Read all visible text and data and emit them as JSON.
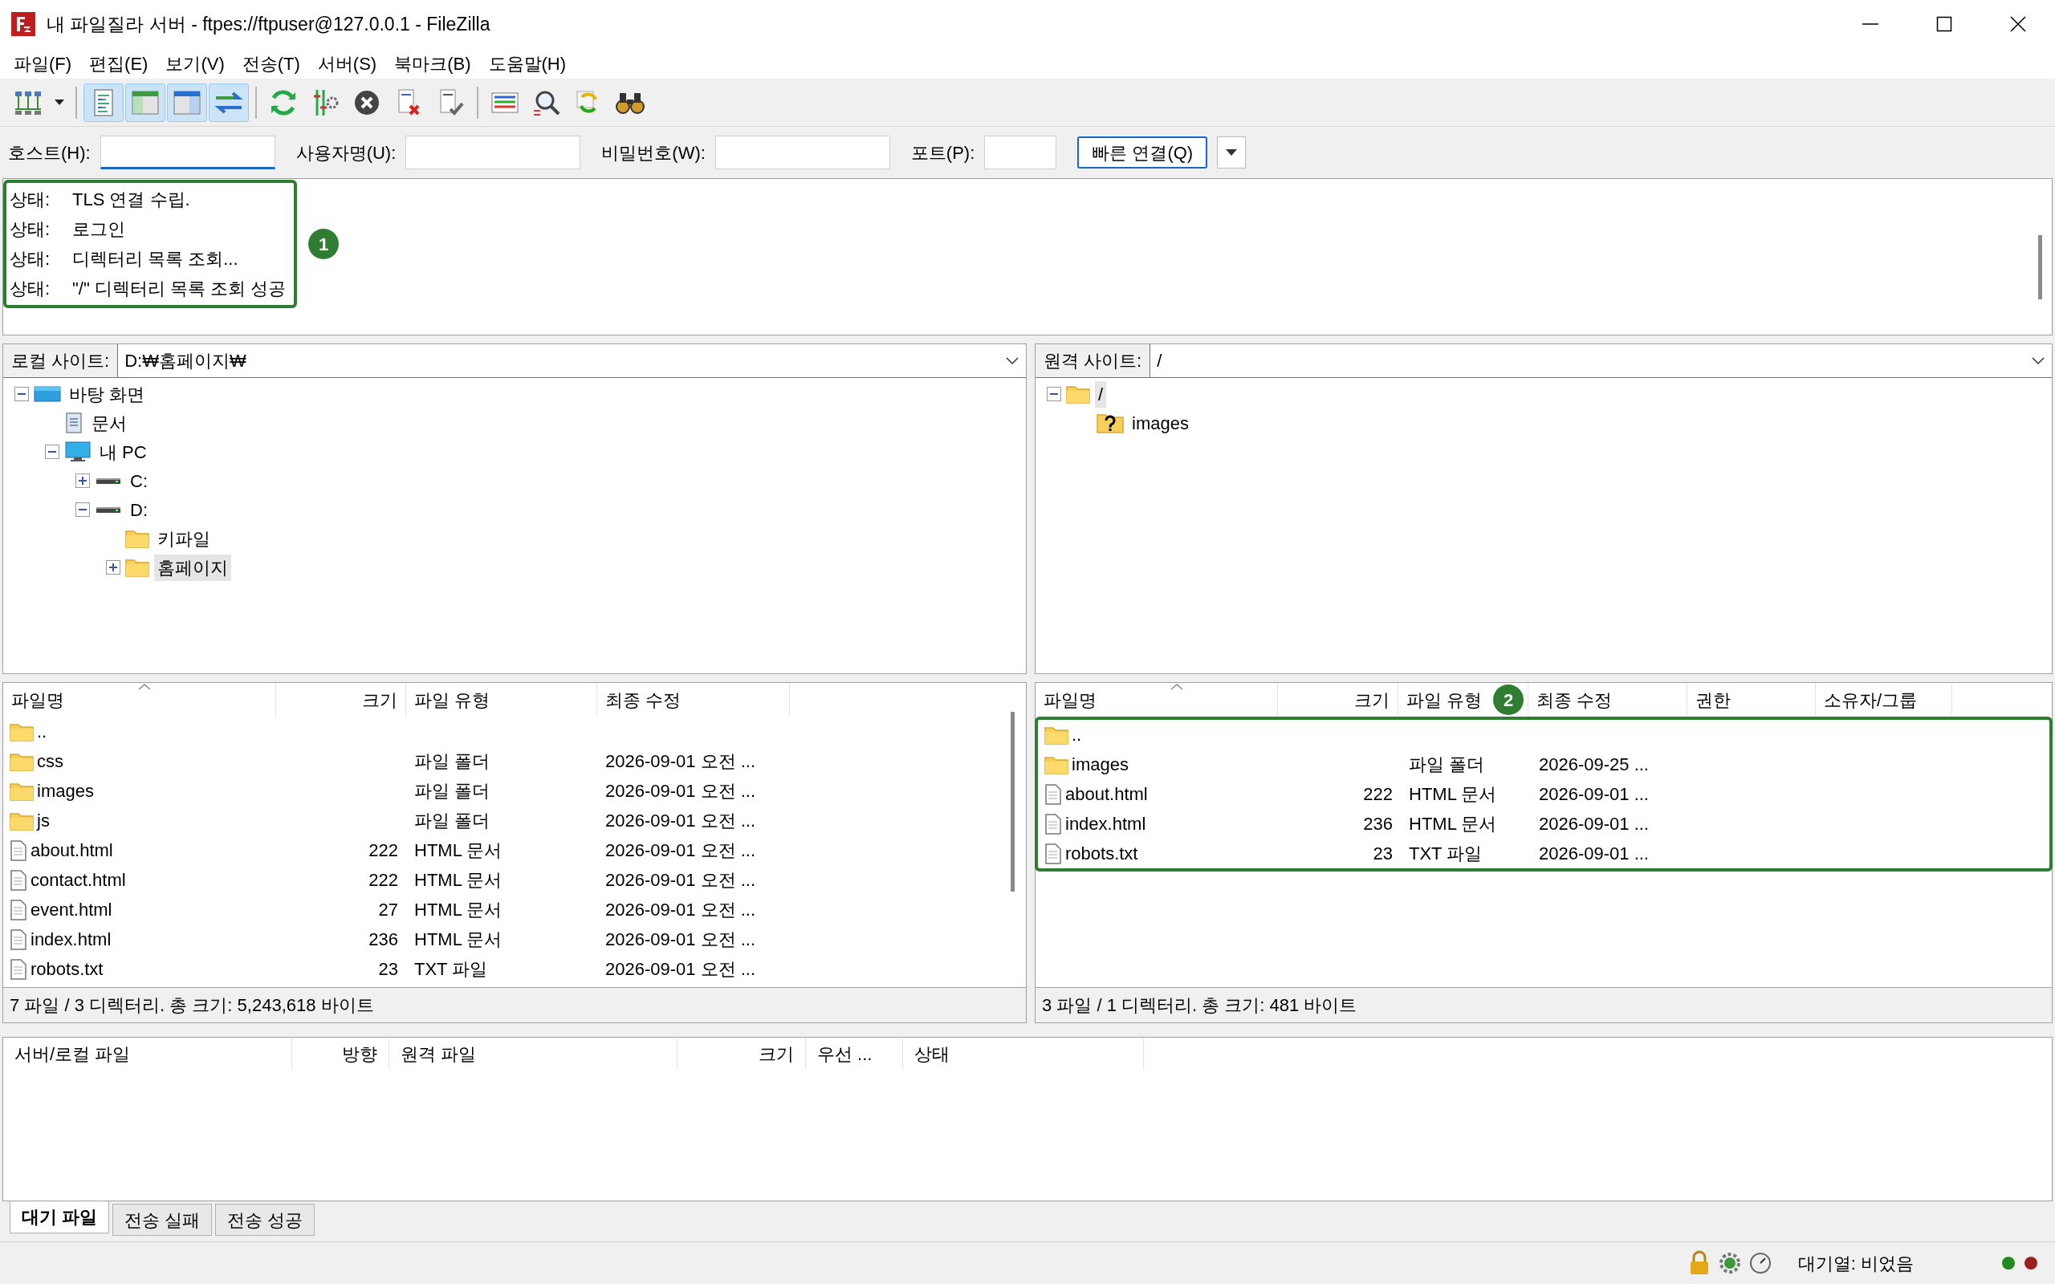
{
  "window": {
    "title": "내 파일질라 서버 - ftpes://ftpuser@127.0.0.1 - FileZilla"
  },
  "menu": [
    "파일(F)",
    "편집(E)",
    "보기(V)",
    "전송(T)",
    "서버(S)",
    "북마크(B)",
    "도움말(H)"
  ],
  "toolbar": [
    [
      {
        "kind": "site-manager",
        "pressed": false
      },
      {
        "kind": "dropdown",
        "pressed": false
      }
    ],
    [
      {
        "kind": "log",
        "pressed": true
      },
      {
        "kind": "local-tree",
        "pressed": true
      },
      {
        "kind": "remote-tree",
        "pressed": true
      },
      {
        "kind": "queue",
        "pressed": true
      }
    ],
    [
      {
        "kind": "refresh",
        "pressed": false
      },
      {
        "kind": "process",
        "pressed": false
      },
      {
        "kind": "cancel",
        "pressed": false
      },
      {
        "kind": "disconnect",
        "pressed": false
      },
      {
        "kind": "reconnect",
        "pressed": false
      }
    ],
    [
      {
        "kind": "compare",
        "pressed": false
      },
      {
        "kind": "filter",
        "pressed": false
      },
      {
        "kind": "sync",
        "pressed": false
      },
      {
        "kind": "search",
        "pressed": false
      }
    ]
  ],
  "quick_connect": {
    "fields": [
      {
        "label": "호스트(H):",
        "focused": true
      },
      {
        "label": "사용자명(U):",
        "focused": false
      },
      {
        "label": "비밀번호(W):",
        "focused": false
      },
      {
        "label": "포트(P):",
        "focused": false
      }
    ],
    "button": "빠른 연결(Q)"
  },
  "message_log": {
    "callout": "1",
    "lines": [
      {
        "label": "상태:",
        "text": "TLS 연결 수립."
      },
      {
        "label": "상태:",
        "text": "로그인"
      },
      {
        "label": "상태:",
        "text": "디렉터리 목록 조회..."
      },
      {
        "label": "상태:",
        "text": "\"/\" 디렉터리 목록 조회 성공"
      }
    ]
  },
  "local": {
    "site_label": "로컬 사이트:",
    "path": "D:₩홈페이지₩",
    "tree": [
      {
        "label": "바탕 화면",
        "kind": "desktop",
        "expanded": true,
        "selected": false,
        "children": [
          {
            "label": "문서",
            "kind": "document",
            "selected": false
          },
          {
            "label": "내 PC",
            "kind": "pc",
            "expanded": true,
            "selected": false,
            "children": [
              {
                "label": "C:",
                "kind": "drive",
                "expanded": false,
                "selected": false
              },
              {
                "label": "D:",
                "kind": "drive",
                "expanded": true,
                "selected": false,
                "children": [
                  {
                    "label": "키파일",
                    "kind": "folder",
                    "selected": false
                  },
                  {
                    "label": "홈페이지",
                    "kind": "folder",
                    "expanded": false,
                    "selected": true
                  }
                ]
              }
            ]
          }
        ]
      }
    ],
    "columns": [
      "파일명",
      "크기",
      "파일 유형",
      "최종 수정"
    ],
    "rows": [
      {
        "kind": "folder",
        "name": ".."
      },
      {
        "kind": "folder",
        "name": "css",
        "type": "파일 폴더",
        "modified": "2026-09-01 오전 ..."
      },
      {
        "kind": "folder",
        "name": "images",
        "type": "파일 폴더",
        "modified": "2026-09-01 오전 ..."
      },
      {
        "kind": "folder",
        "name": "js",
        "type": "파일 폴더",
        "modified": "2026-09-01 오전 ..."
      },
      {
        "kind": "file",
        "name": "about.html",
        "size": "222",
        "type": "HTML 문서",
        "modified": "2026-09-01 오전 ..."
      },
      {
        "kind": "file",
        "name": "contact.html",
        "size": "222",
        "type": "HTML 문서",
        "modified": "2026-09-01 오전 ..."
      },
      {
        "kind": "file",
        "name": "event.html",
        "size": "27",
        "type": "HTML 문서",
        "modified": "2026-09-01 오전 ..."
      },
      {
        "kind": "file",
        "name": "index.html",
        "size": "236",
        "type": "HTML 문서",
        "modified": "2026-09-01 오전 ..."
      },
      {
        "kind": "file",
        "name": "robots.txt",
        "size": "23",
        "type": "TXT 파일",
        "modified": "2026-09-01 오전 ..."
      }
    ],
    "summary": "7 파일 / 3 디렉터리. 총 크기: 5,243,618 바이트"
  },
  "remote": {
    "site_label": "원격 사이트:",
    "path": "/",
    "tree": [
      {
        "label": "/",
        "kind": "folder",
        "expanded": true,
        "selected": true,
        "children": [
          {
            "label": "images",
            "kind": "unknown-folder",
            "selected": false
          }
        ]
      }
    ],
    "columns": [
      "파일명",
      "크기",
      "파일 유형",
      "최종 수정",
      "권한",
      "소유자/그룹"
    ],
    "callout": "2",
    "rows": [
      {
        "kind": "folder",
        "name": ".."
      },
      {
        "kind": "folder",
        "name": "images",
        "type": "파일 폴더",
        "modified": "2026-09-25 ..."
      },
      {
        "kind": "file",
        "name": "about.html",
        "size": "222",
        "type": "HTML 문서",
        "modified": "2026-09-01 ..."
      },
      {
        "kind": "file",
        "name": "index.html",
        "size": "236",
        "type": "HTML 문서",
        "modified": "2026-09-01 ..."
      },
      {
        "kind": "file",
        "name": "robots.txt",
        "size": "23",
        "type": "TXT 파일",
        "modified": "2026-09-01 ..."
      }
    ],
    "summary": "3 파일 / 1 디렉터리. 총 크기: 481 바이트"
  },
  "queue": {
    "columns": [
      "서버/로컬 파일",
      "방향",
      "원격 파일",
      "크기",
      "우선 ...",
      "상태"
    ]
  },
  "queue_tabs": [
    {
      "label": "대기 파일",
      "selected": true
    },
    {
      "label": "전송 실패",
      "selected": false
    },
    {
      "label": "전송 성공",
      "selected": false
    }
  ],
  "status_bar": {
    "queue": "대기열: 비었음"
  }
}
